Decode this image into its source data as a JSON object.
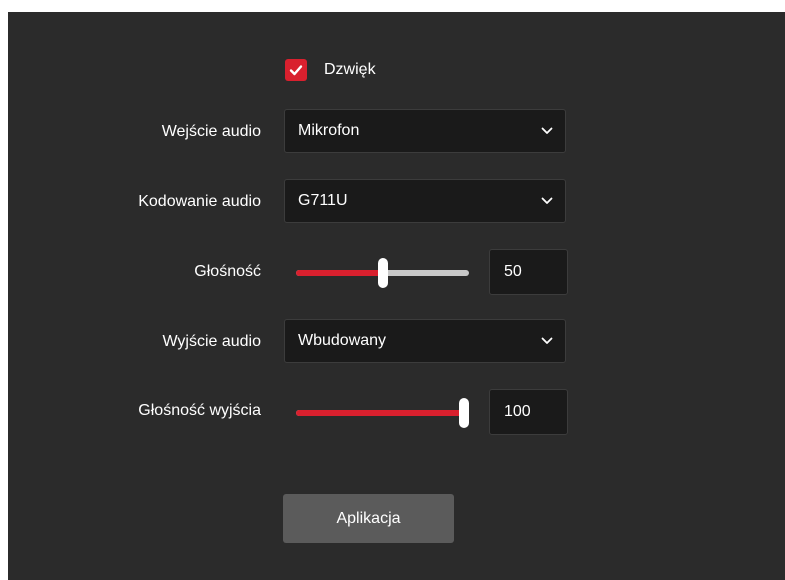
{
  "sound": {
    "label": "Dzwięk",
    "checked": true
  },
  "audio_input": {
    "label": "Wejście audio",
    "value": "Mikrofon"
  },
  "audio_encoding": {
    "label": "Kodowanie audio",
    "value": "G711U"
  },
  "volume": {
    "label": "Głośność",
    "value": "50",
    "level": 50
  },
  "audio_output": {
    "label": "Wyjście audio",
    "value": "Wbudowany"
  },
  "output_volume": {
    "label": "Głośność wyjścia",
    "value": "100",
    "level": 100
  },
  "apply_button": {
    "label": "Aplikacja"
  },
  "colors": {
    "accent": "#d9202e",
    "panel": "#2b2b2b",
    "field": "#1a1a1a",
    "button": "#5b5b5b"
  }
}
